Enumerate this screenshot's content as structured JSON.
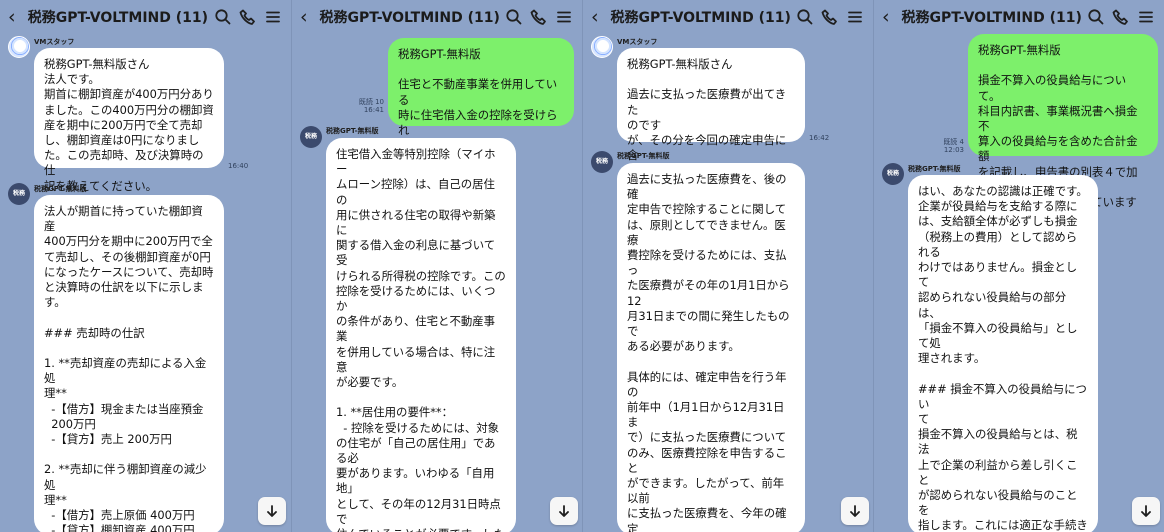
{
  "app": {
    "title": "税務GPT-VOLTMIND (11)"
  },
  "icons": {
    "back": "back-icon",
    "search": "search-icon",
    "call": "call-icon",
    "menu": "menu-icon",
    "scroll_down": "arrow-down-icon"
  },
  "colors": {
    "background": "#8da3c8",
    "user_bubble": "#7df06b",
    "bot_bubble": "#ffffff"
  },
  "panels": [
    {
      "messages": [
        {
          "sender": "VMスタッフ",
          "text": "税務GPT-無料版さん\n法人です。\n期首に棚卸資産が400万円分あり\nました。この400万円分の棚卸資\n産を期中に200万円で全て売却\nし、棚卸資産は0円になりまし\nた。この売却時、及び決算時の仕\n訳を教えてください。",
          "time": "16:40"
        },
        {
          "sender": "税務GPT-無料版",
          "avatar_text": "税務GPT",
          "text": "法人が期首に持っていた棚卸資産\n400万円分を期中に200万円で全\nて売却し、その後棚卸資産が0円\nになったケースについて、売却時\nと決算時の仕訳を以下に示します。\n\n### 売却時の仕訳\n\n1. **売却資産の売却による入金処\n理**\n  -【借方】現金または当座預金\n  200万円\n  -【貸方】売上 200万円\n\n2. **売却に伴う棚卸資産の減少処\n理**\n  -【借方】売上原価 400万円\n  -【貸方】棚卸資産 400万円\n\nこの仕訳により、棚卸資産は帳簿\n上から減少し、売却による実際の\n入金とそれに伴う売上、そして売\n上原価が反映されます。売却によ"
        }
      ]
    },
    {
      "messages": [
        {
          "text": "税務GPT-無料版\n\n住宅と不動産事業を併用している\n時に住宅借入金の控除を受けられ\nるか？",
          "status": "既読 10",
          "time": "16:41"
        },
        {
          "sender": "税務GPT-無料版",
          "avatar_text": "税務GPT",
          "text": "住宅借入金等特別控除（マイホー\nムローン控除）は、自己の居住の\n用に供される住宅の取得や新築に\n関する借入金の利息に基づいて受\nけられる所得税の控除です。この\n控除を受けるためには、いくつか\nの条件があり、住宅と不動産事業\nを併用している場合は、特に注意\nが必要です。\n\n1. **居住用の要件**：\n  - 控除を受けるためには、対象\nの住宅が「自己の居住用」である必\n要があります。いわゆる「自用地」\nとして、その年の12月31日時点で\n住んでいることが必要です。した\nがって、住宅部分が自己の居住用\nとして実際に使用されている必要\nがあります。\n\n2. **不動産事業の部分の取り扱い\n**：\n  - 不動産事業用（たとえば賃貸\n用）の部分と住宅部分が物理的に\n分割されている場合、住宅部分が\n自己居住用の条件を満たしていれ\nば、その部分にかかる借入金の利"
        }
      ]
    },
    {
      "messages": [
        {
          "sender": "VMスタッフ",
          "text": "税務GPT-無料版さん\n\n過去に支払った医療費が出てきた\nのです\nが、その分を今回の確定申告に含\nめて計算しても良いでしょうか？",
          "time": "16:42"
        },
        {
          "sender": "税務GPT-無料版",
          "avatar_text": "税務GPT",
          "text": "過去に支払った医療費を、後の確\n定申告で控除することに関して\nは、原則としてできません。医療\n費控除を受けるためには、支払っ\nた医療費がその年の1月1日から12\n月31日までの間に発生したもので\nある必要があります。\n\n具体的には、確定申告を行う年の\n前年中（1月1日から12月31日ま\nで）に支払った医療費について\nのみ、医療費控除を申告すること\nができます。したがって、前年以前\nに支払った医療費を、今年の確定\n申告に含めて控除を受けることは\nできません。\n\nもし該当する医療費がある場合に\nは、それが発生した年度の確定申\n告において適切に申告することが\n必要です。過去のものについて\nは、その年度の確定申告の訂正申\n告を行うという手段がありますが\nが、訂正申告には所定の期限があ\nるため、その年度から過度に時が"
        }
      ]
    },
    {
      "messages": [
        {
          "text": "税務GPT-無料版\n\n損金不算入の役員給与について。\n科目内訳書、事業概況書へ損金不\n算入の役員給与を含めた合計金額\nを記載し、申告書の別表４で加算\n処理を行う認識であっています\nか？",
          "status": "既読 4",
          "time": "12:03"
        },
        {
          "sender": "税務GPT-無料版",
          "avatar_text": "税務GPT",
          "text": "はい、あなたの認識は正確です。\n企業が役員給与を支給する際に\nは、支給額全体が必ずしも損金\n（税務上の費用）として認められる\nわけではありません。損金として\n認められない役員給与の部分は、\n「損金不算入の役員給与」として処\n理されます。\n\n### 損金不算入の役員給与につい\nて\n損金不算入の役員給与とは、税法\n上で企業の利益から差し引くこと\nが認められない役員給与のことを\n指します。これには適正な手続き\nを経ていない給与や、相場を大幅\nに超える給与などが含まれます。\n\n### 帳簿への記載\n- **科目内訳書および事業概況書\n**：損金不算入の役員給与を含め\nた役員給与の合計金額は、財務諸\n表の一部である科目内訳書や事業\n概況書に記載します。これは、会\n計上の取り扱いとして正確に反映"
        }
      ]
    }
  ]
}
